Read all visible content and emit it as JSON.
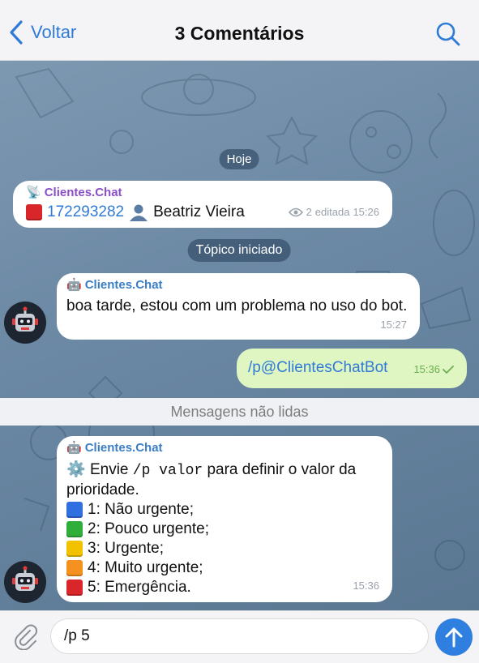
{
  "header": {
    "back_label": "Voltar",
    "title": "3 Comentários"
  },
  "chat": {
    "date_label": "Hoje",
    "topic_label": "Tópico iniciado",
    "unread_label": "Mensagens não lidas",
    "msg1": {
      "sender": "Clientes.Chat",
      "id_number": "172293282",
      "name": "Beatriz Vieira",
      "views": "2",
      "edited_label": "editada",
      "time": "15:26"
    },
    "msg2": {
      "sender": "Clientes.Chat",
      "text": "boa tarde, estou com um problema no uso do bot.",
      "time": "15:27"
    },
    "msg3": {
      "text": "/p@ClientesChatBot",
      "time": "15:36"
    },
    "msg4": {
      "sender": "Clientes.Chat",
      "intro_prefix": "Envie",
      "command": "/p valor",
      "intro_suffix": "para definir o valor da prioridade.",
      "options": [
        {
          "label": "1: Não urgente;",
          "color": "#2f6fe0"
        },
        {
          "label": "2: Pouco urgente;",
          "color": "#2fae3a"
        },
        {
          "label": "3: Urgente;",
          "color": "#f2c200"
        },
        {
          "label": "4: Muito urgente;",
          "color": "#f5911e"
        },
        {
          "label": "5: Emergência.",
          "color": "#d9262a"
        }
      ],
      "time": "15:36"
    }
  },
  "composer": {
    "input_value": "/p 5"
  },
  "colors": {
    "accent": "#2f7fe0",
    "outgoing_bubble": "#dff5c2",
    "chat_bg": "#6a87a3"
  }
}
